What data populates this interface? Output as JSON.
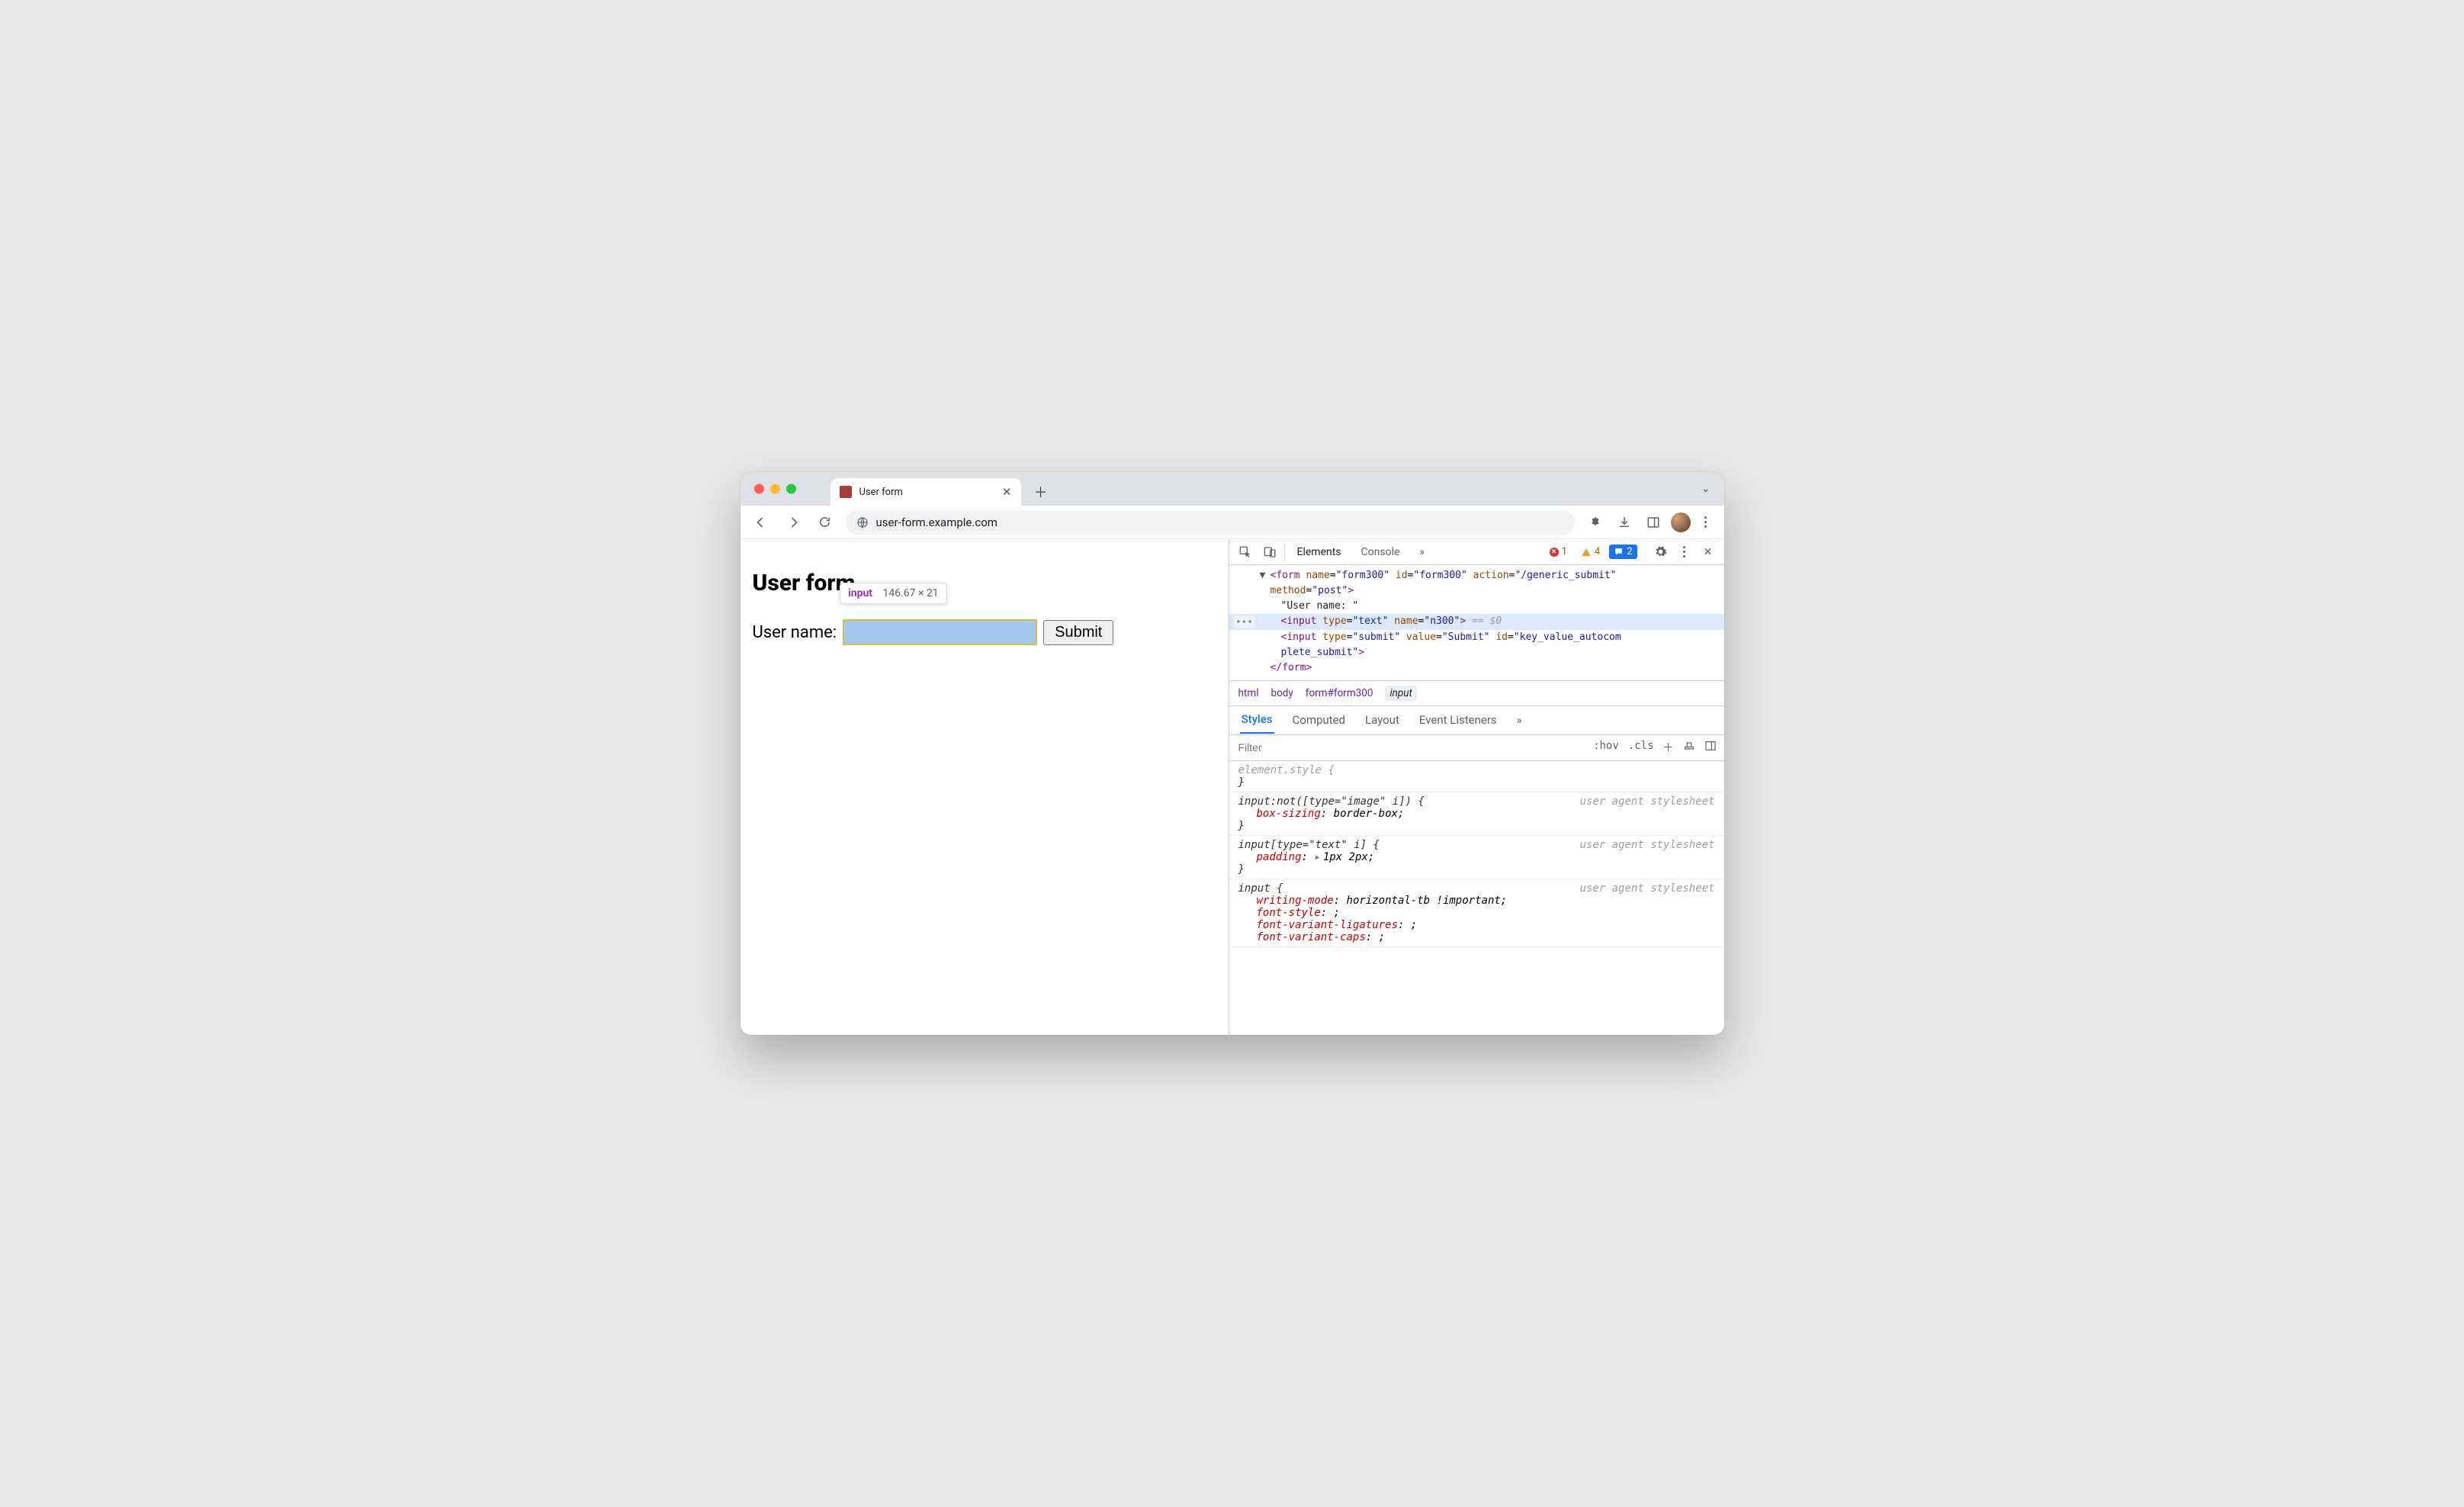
{
  "browser": {
    "tab_title": "User form",
    "url": "user-form.example.com"
  },
  "page": {
    "heading": "User form",
    "label": "User name:",
    "submit": "Submit",
    "inspect_tooltip": {
      "tag": "input",
      "dims": "146.67 × 21"
    }
  },
  "devtools": {
    "tabs": {
      "elements": "Elements",
      "console": "Console",
      "more": "»"
    },
    "counts": {
      "errors": "1",
      "warnings": "4",
      "issues": "2"
    },
    "dom": {
      "form_open_a": "<form",
      "form_open_attrs": " name=\"form300\" id=\"form300\" action=\"/generic_submit\"",
      "form_open_b": " method=\"post\">",
      "text_node": "\"User name: \"",
      "input_text": "<input type=\"text\" name=\"n300\">",
      "eq0": " == $0",
      "input_submit_a": "<input type=\"submit\" value=\"Submit\" id=\"key_value_autocom",
      "input_submit_b": "plete_submit\">",
      "form_close": "</form>"
    },
    "crumbs": {
      "c1": "html",
      "c2": "body",
      "c3": "form#form300",
      "c4": "input"
    },
    "subtabs": {
      "styles": "Styles",
      "computed": "Computed",
      "layout": "Layout",
      "events": "Event Listeners",
      "more": "»"
    },
    "filter": {
      "placeholder": "Filter",
      "hov": ":hov",
      "cls": ".cls"
    },
    "rules": {
      "r0_sel": "element.style {",
      "r1_sel": "input:not([type=\"image\" i]) {",
      "r1_prop": "box-sizing",
      "r1_val": ": border-box;",
      "r2_sel": "input[type=\"text\" i] {",
      "r2_prop": "padding",
      "r2_val": "1px 2px;",
      "r3_sel": "input {",
      "r3_p1": "writing-mode",
      "r3_v1": ": horizontal-tb !important;",
      "r3_p2": "font-style",
      "r3_v2": ": ;",
      "r3_p3": "font-variant-ligatures",
      "r3_v3": ": ;",
      "r3_p4": "font-variant-caps",
      "r3_v4": ": ;",
      "ua_sheet": "user agent stylesheet",
      "close_brace": "}"
    }
  }
}
